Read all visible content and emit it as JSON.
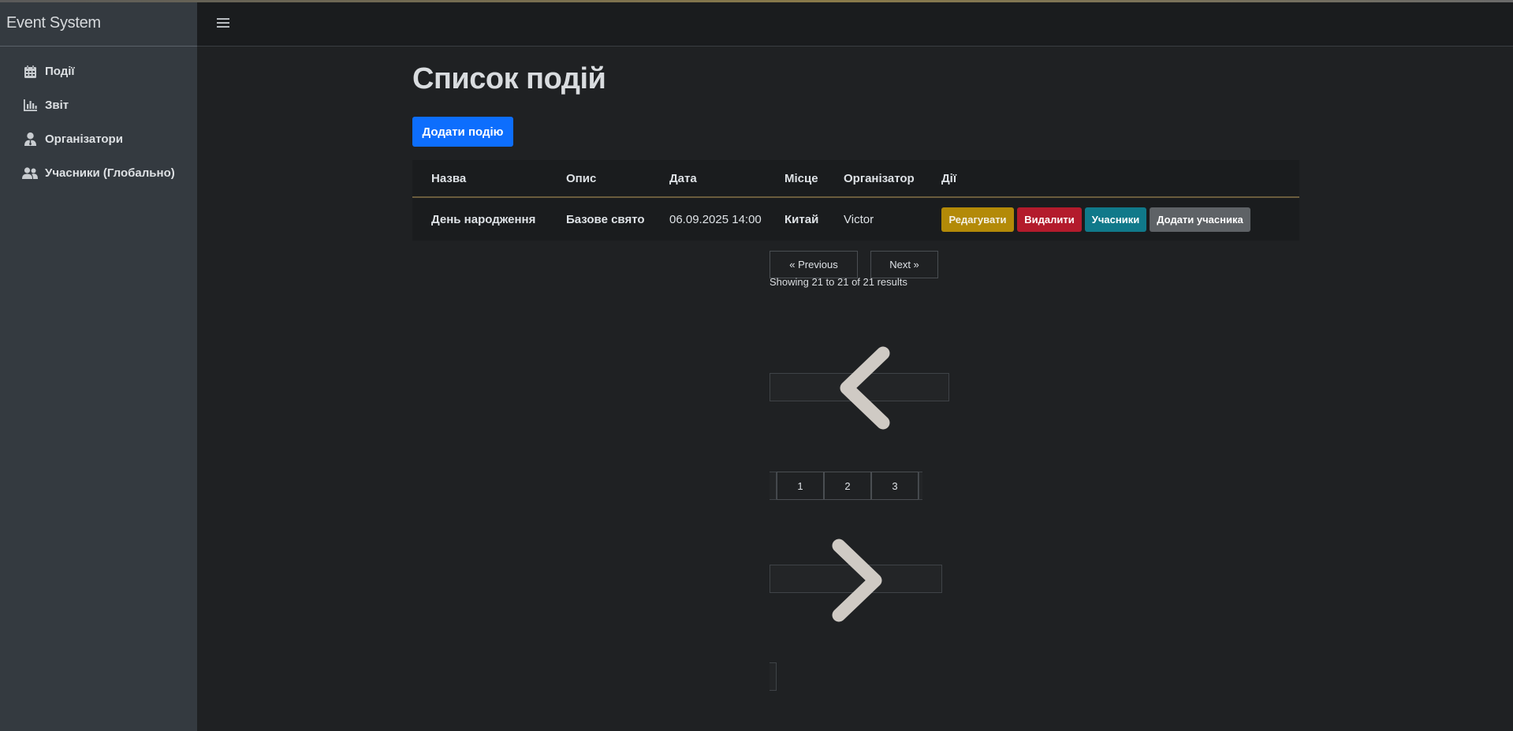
{
  "app": {
    "brand": "Event System"
  },
  "sidebar": {
    "items": [
      {
        "label": "Події",
        "icon": "calendar-icon"
      },
      {
        "label": "Звіт",
        "icon": "bar-chart-icon"
      },
      {
        "label": "Організатори",
        "icon": "user-tie-icon"
      },
      {
        "label": "Учасники (Глобально)",
        "icon": "users-icon"
      }
    ]
  },
  "main": {
    "title": "Список подій",
    "add_button": "Додати подію",
    "table": {
      "headers": [
        "Назва",
        "Опис",
        "Дата",
        "Місце",
        "Організатор",
        "Дії"
      ],
      "rows": [
        {
          "name": "День народження",
          "description": "Базове свято",
          "date": "06.09.2025 14:00",
          "place": "Китай",
          "organizer": "Victor",
          "actions": [
            "Редагувати",
            "Видалити",
            "Учасники",
            "Додати учасника"
          ]
        }
      ]
    },
    "pagination": {
      "previous": "« Previous",
      "next": "Next »",
      "showing": "Showing 21 to 21 of 21 results",
      "pages": [
        "1",
        "2",
        "3"
      ]
    }
  },
  "colors": {
    "primary": "#0d6efd",
    "warning": "#b38a08",
    "danger": "#b31b2c",
    "info": "#10798a",
    "secondary": "#5e6266"
  }
}
